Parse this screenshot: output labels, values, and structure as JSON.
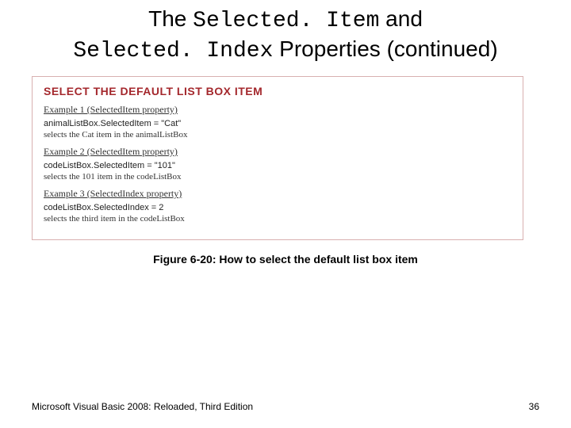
{
  "title": {
    "pre1": "The ",
    "code1": "Selected. Item",
    "mid1": " and ",
    "code2": "Selected. Index",
    "post": " Properties (continued)"
  },
  "figure": {
    "heading": "SELECT THE DEFAULT LIST BOX ITEM",
    "examples": [
      {
        "label": "Example 1 (SelectedItem property)",
        "code": "animalListBox.SelectedItem = \"Cat\"",
        "desc": "selects the Cat item in the animalListBox"
      },
      {
        "label": "Example 2 (SelectedItem property)",
        "code": "codeListBox.SelectedItem = \"101\"",
        "desc": "selects the 101 item in the codeListBox"
      },
      {
        "label": "Example 3 (SelectedIndex property)",
        "code": "codeListBox.SelectedIndex = 2",
        "desc": "selects the third item in the codeListBox"
      }
    ]
  },
  "caption": "Figure 6-20: How to select the default list box item",
  "footer": {
    "left": "Microsoft Visual Basic 2008: Reloaded, Third Edition",
    "right": "36"
  }
}
